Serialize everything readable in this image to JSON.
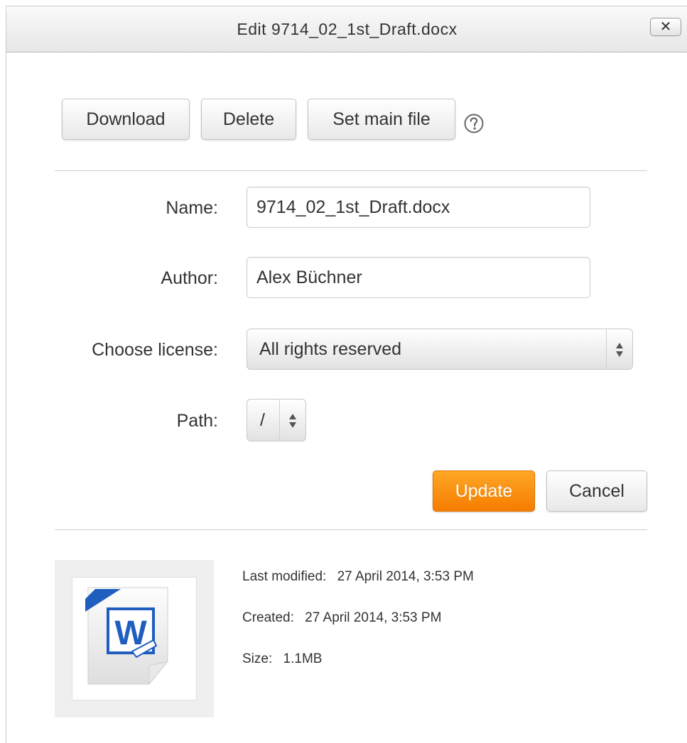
{
  "dialog": {
    "title": "Edit 9714_02_1st_Draft.docx",
    "close_label": "✕"
  },
  "toolbar": {
    "download_label": "Download",
    "delete_label": "Delete",
    "set_main_label": "Set main file",
    "help_icon": "help-icon"
  },
  "form": {
    "name_label": "Name:",
    "name_value": "9714_02_1st_Draft.docx",
    "author_label": "Author:",
    "author_value": "Alex Büchner",
    "license_label": "Choose license:",
    "license_value": "All rights reserved",
    "path_label": "Path:",
    "path_value": "/"
  },
  "actions": {
    "update_label": "Update",
    "cancel_label": "Cancel"
  },
  "file_info": {
    "icon": "word-document-icon",
    "last_modified_label": "Last modified:",
    "last_modified_value": "27 April 2014, 3:53 PM",
    "created_label": "Created:",
    "created_value": "27 April 2014, 3:53 PM",
    "size_label": "Size:",
    "size_value": "1.1MB"
  },
  "colors": {
    "primary_button": "#f57c00",
    "word_blue": "#1f5ebf"
  }
}
